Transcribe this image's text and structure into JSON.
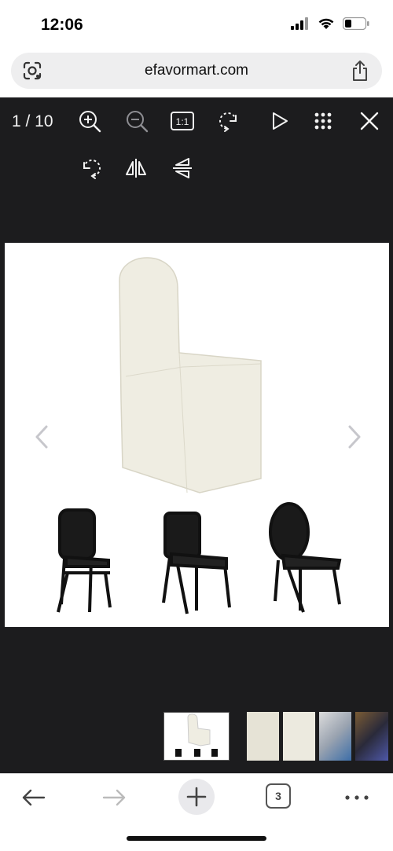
{
  "status": {
    "time": "12:06"
  },
  "browser": {
    "url": "efavormart.com",
    "tab_count": "3"
  },
  "viewer": {
    "counter": "1 / 10",
    "toolbar_icons": [
      "zoom-in-icon",
      "zoom-out-icon",
      "actual-size-icon",
      "rotate-left-icon",
      "play-icon",
      "grid-icon",
      "close-icon",
      "rotate-right-icon",
      "flip-horizontal-icon",
      "flip-vertical-icon"
    ],
    "actual_size_label": "1:1"
  },
  "colors": {
    "viewer_bg": "#1c1c1e",
    "accent_icon": "#f2f2f2",
    "chair_cover": "#efede2"
  }
}
